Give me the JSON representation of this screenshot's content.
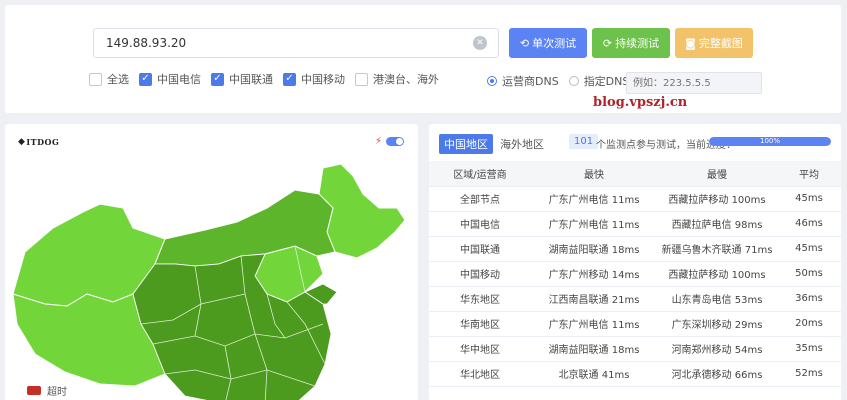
{
  "search": {
    "ip_value": "149.88.93.20",
    "buttons": {
      "single_test": "单次测试",
      "continuous_test": "持续测试",
      "full_screenshot": "完整截图"
    }
  },
  "isp_filters": [
    {
      "label": "全选",
      "checked": false
    },
    {
      "label": "中国电信",
      "checked": true
    },
    {
      "label": "中国联通",
      "checked": true
    },
    {
      "label": "中国移动",
      "checked": true
    },
    {
      "label": "港澳台、海外",
      "checked": false
    }
  ],
  "dns": {
    "option_isp": "运营商DNS",
    "option_custom": "指定DNS:",
    "selected": "运营商DNS",
    "custom_placeholder": "例如：223.5.5.5"
  },
  "watermark": "blog.vpszj.cn",
  "map": {
    "logo_text": "ITDOG",
    "legend_label": "超时",
    "colors": {
      "light": "#72d63a",
      "mid": "#5cb52a",
      "dark": "#4c9a1e",
      "timeout": "#c43025"
    }
  },
  "results": {
    "tabs": [
      "中国地区",
      "海外地区"
    ],
    "active_tab": "中国地区",
    "node_count": "101",
    "progress_label": "个监测点参与测试，当前进度：",
    "progress_percent": 100,
    "progress_text": "100%",
    "columns": [
      "区域/运营商",
      "最快",
      "最慢",
      "平均"
    ],
    "rows": [
      [
        "全部节点",
        "广东广州电信 11ms",
        "西藏拉萨移动 100ms",
        "45ms"
      ],
      [
        "中国电信",
        "广东广州电信 11ms",
        "西藏拉萨电信 98ms",
        "46ms"
      ],
      [
        "中国联通",
        "湖南益阳联通 18ms",
        "新疆乌鲁木齐联通 71ms",
        "45ms"
      ],
      [
        "中国移动",
        "广东广州移动 14ms",
        "西藏拉萨移动 100ms",
        "50ms"
      ],
      [
        "华东地区",
        "江西南昌联通 21ms",
        "山东青岛电信 53ms",
        "36ms"
      ],
      [
        "华南地区",
        "广东广州电信 11ms",
        "广东深圳移动 29ms",
        "20ms"
      ],
      [
        "华中地区",
        "湖南益阳联通 18ms",
        "河南郑州移动 54ms",
        "35ms"
      ],
      [
        "华北地区",
        "北京联通 41ms",
        "河北承德移动 66ms",
        "52ms"
      ]
    ]
  }
}
